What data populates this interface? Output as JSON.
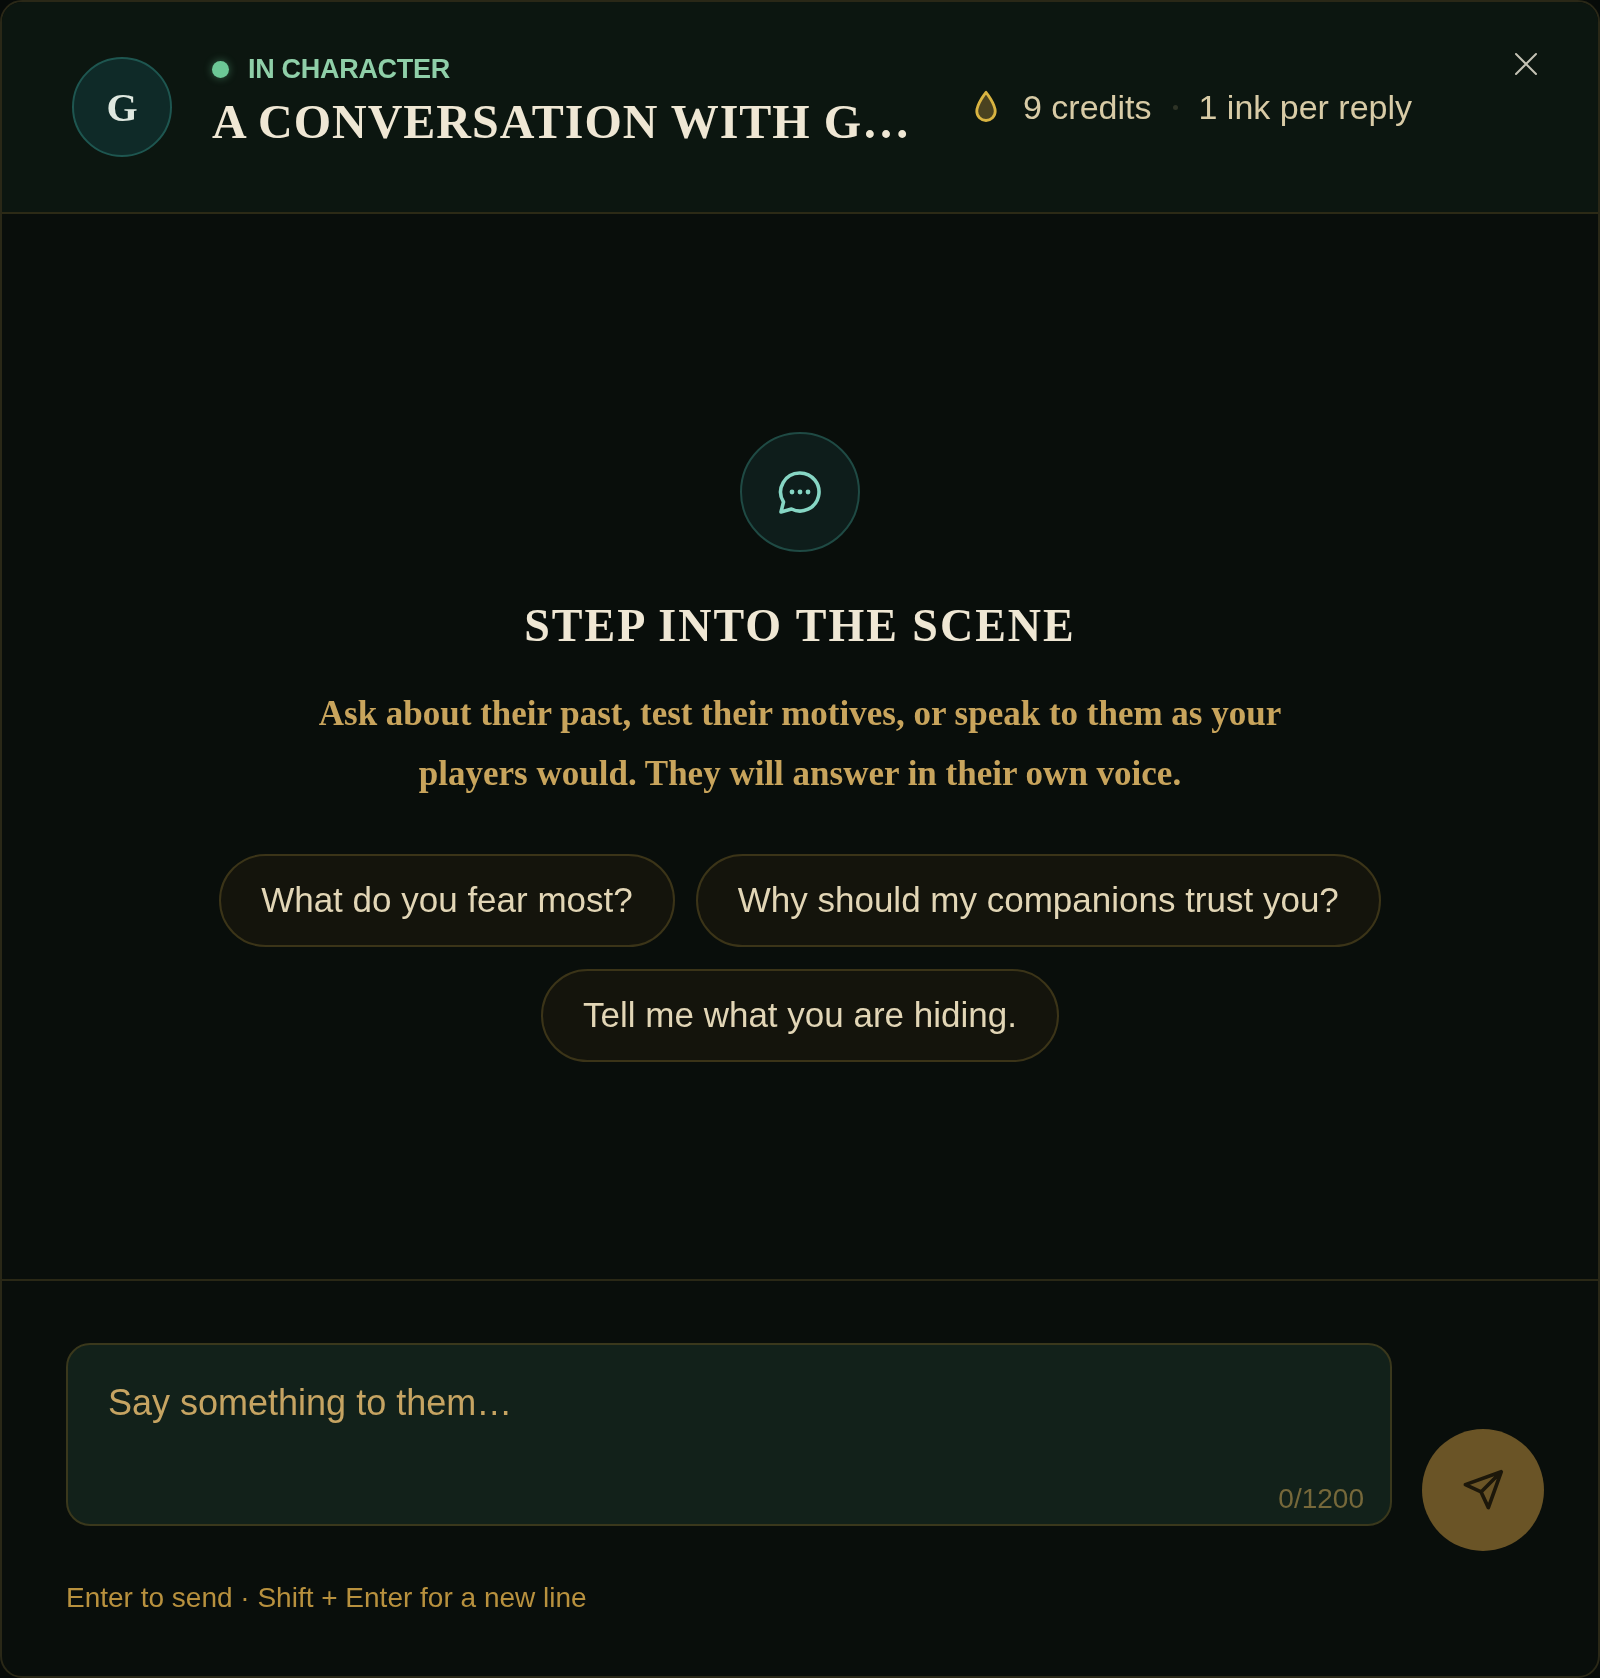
{
  "header": {
    "avatar_initial": "G",
    "status": {
      "label": "IN CHARACTER",
      "active": true
    },
    "title": "A CONVERSATION WITH G…",
    "credits": "9 credits",
    "cost": "1 ink per reply"
  },
  "empty_state": {
    "title": "STEP INTO THE SCENE",
    "description": "Ask about their past, test their motives, or speak to them as your players would. They will answer in their own voice."
  },
  "suggestions": [
    "What do you fear most?",
    "Why should my companions trust you?",
    "Tell me what you are hiding."
  ],
  "composer": {
    "placeholder": "Say something to them…",
    "counter": "0/1200",
    "hint": "Enter to send · Shift + Enter for a new line"
  }
}
